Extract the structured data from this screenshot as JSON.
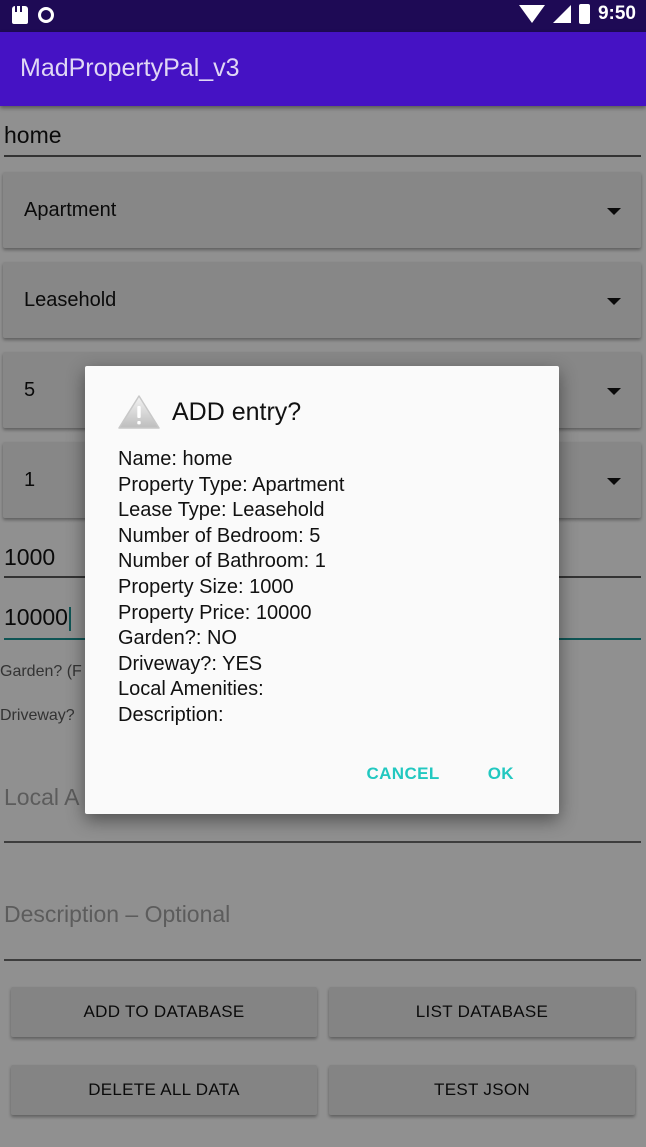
{
  "status_bar": {
    "time": "9:50"
  },
  "app_bar": {
    "title": "MadPropertyPal_v3"
  },
  "form": {
    "name_value": "home",
    "property_type": "Apartment",
    "lease_type": "Leasehold",
    "bedrooms": "5",
    "bathrooms": "1",
    "size_value": "1000",
    "price_value": "10000",
    "garden_label": "Garden? (F",
    "driveway_label": "Driveway?",
    "amenities_placeholder": "Local A",
    "description_placeholder": "Description – Optional"
  },
  "buttons": {
    "add": "ADD TO DATABASE",
    "list": "LIST DATABASE",
    "delete": "DELETE ALL DATA",
    "test_json": "TEST JSON"
  },
  "dialog": {
    "title": "ADD entry?",
    "lines": [
      "Name: home",
      "Property Type: Apartment",
      "Lease Type: Leasehold",
      "Number of Bedroom: 5",
      "Number of Bathroom: 1",
      "Property Size: 1000",
      "Property Price: 10000",
      "Garden?: NO",
      "Driveway?: YES",
      "Local Amenities:",
      "Description:"
    ],
    "cancel": "CANCEL",
    "ok": "OK"
  },
  "colors": {
    "app_bar": "#4512c4",
    "status_bar": "#1e0a55",
    "accent": "#22c8c0"
  }
}
